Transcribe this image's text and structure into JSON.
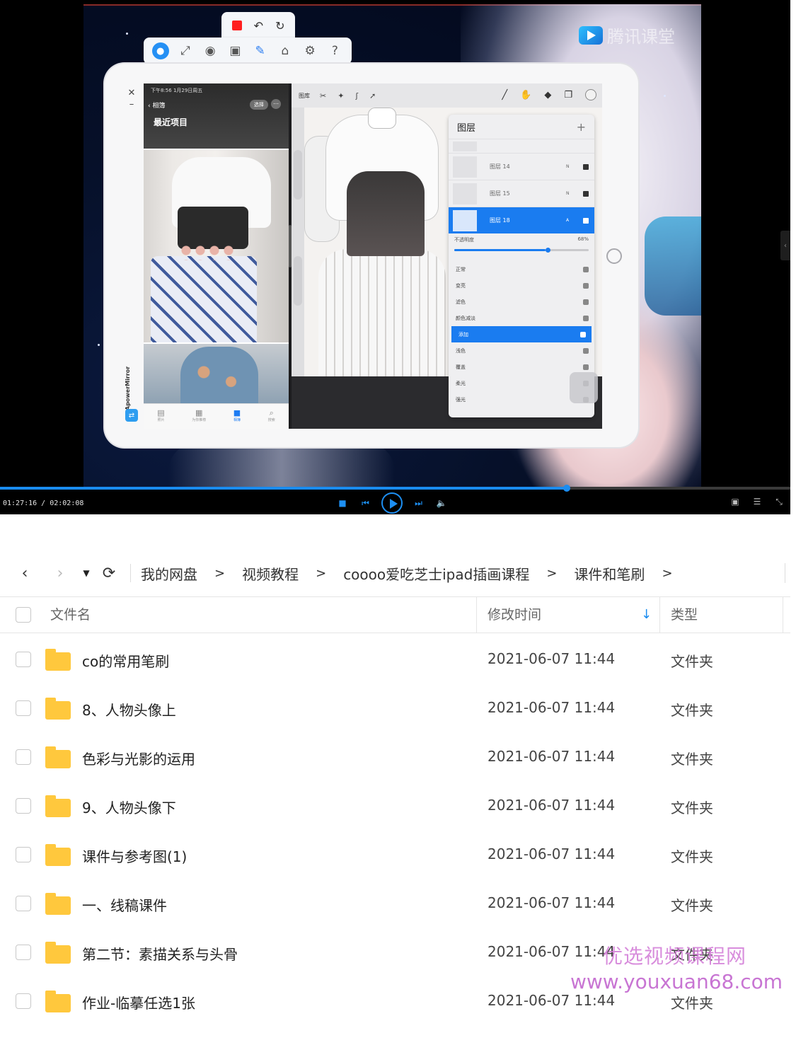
{
  "player": {
    "watermark_brand": "腾讯课堂",
    "progress_fraction": 0.717,
    "time_text": "01:27:16 / 02:02:08",
    "ipad": {
      "mirror_brand": "ApowerMirror",
      "photos": {
        "status": "下午8:56  1月29日周五",
        "back_label": "相簿",
        "select_label": "选择",
        "title": "最近项目",
        "tabs": [
          {
            "label": "照片"
          },
          {
            "label": "为你推荐"
          },
          {
            "label": "相簿"
          },
          {
            "label": "搜索"
          }
        ]
      },
      "procreate": {
        "gallery_label": "图库",
        "layers_title": "图层",
        "layers": [
          {
            "name": "",
            "mode": ""
          },
          {
            "name": "图层 14",
            "mode": "N"
          },
          {
            "name": "图层 15",
            "mode": "N"
          },
          {
            "name": "图层 18",
            "mode": "A"
          }
        ],
        "opacity_label": "不透明度",
        "opacity_value": "68%",
        "opacity_fraction": 0.68,
        "blend_modes": [
          "正常",
          "变亮",
          "滤色",
          "颜色减淡",
          "添加",
          "浅色",
          "覆盖",
          "柔光",
          "强光"
        ],
        "active_blend": "添加"
      }
    }
  },
  "browser": {
    "breadcrumbs": [
      "我的网盘",
      "视频教程",
      "coooo爱吃芝士ipad插画课程",
      "课件和笔刷"
    ],
    "columns": {
      "name": "文件名",
      "modified": "修改时间",
      "type": "类型"
    },
    "files": [
      {
        "name": "co的常用笔刷",
        "modified": "2021-06-07 11:44",
        "type": "文件夹"
      },
      {
        "name": "8、人物头像上",
        "modified": "2021-06-07 11:44",
        "type": "文件夹"
      },
      {
        "name": "色彩与光影的运用",
        "modified": "2021-06-07 11:44",
        "type": "文件夹"
      },
      {
        "name": "9、人物头像下",
        "modified": "2021-06-07 11:44",
        "type": "文件夹"
      },
      {
        "name": "课件与参考图(1)",
        "modified": "2021-06-07 11:44",
        "type": "文件夹"
      },
      {
        "name": "一、线稿课件",
        "modified": "2021-06-07 11:44",
        "type": "文件夹"
      },
      {
        "name": "第二节：素描关系与头骨",
        "modified": "2021-06-07 11:44",
        "type": "文件夹"
      },
      {
        "name": "作业-临摹任选1张",
        "modified": "2021-06-07 11:44",
        "type": "文件夹"
      }
    ]
  },
  "watermark": {
    "site": "优选视频课程网",
    "url": "www.youxuan68.com"
  },
  "colors": {
    "accent": "#1a8cf0",
    "folder": "#ffc83d",
    "record": "#ff1f1f"
  }
}
